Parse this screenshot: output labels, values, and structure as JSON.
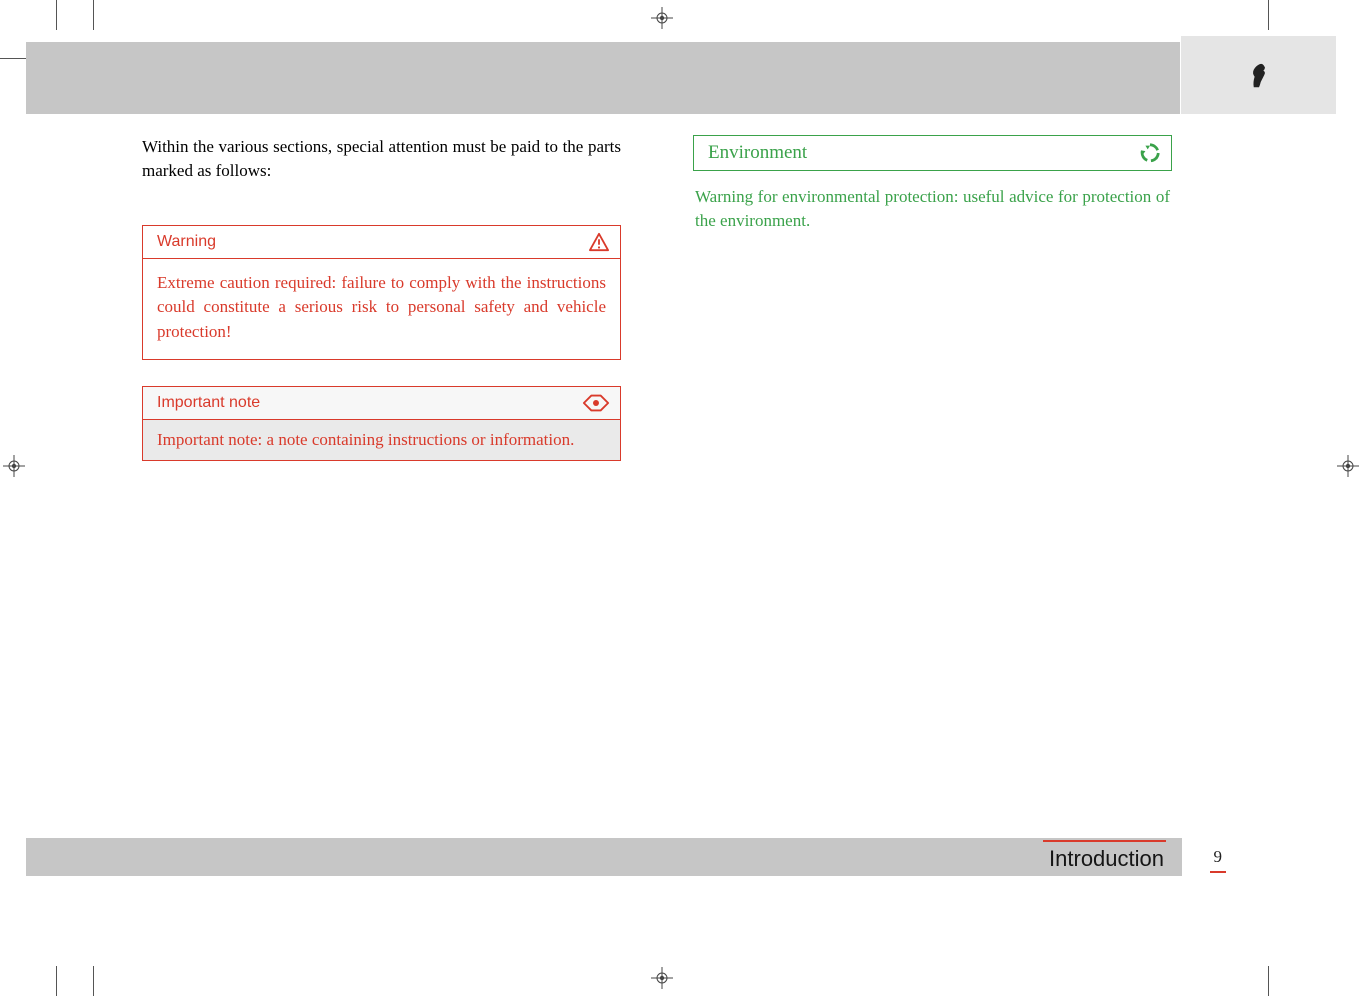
{
  "intro": "Within the various sections, special attention must be paid to the parts marked as follows:",
  "warning": {
    "title": "Warning",
    "body": "Extreme caution required: failure to comply with the instructions could constitute a serious risk to personal safety and vehicle protection!"
  },
  "note": {
    "title": "Important note",
    "body": "Important note: a note containing instructions or information."
  },
  "environment": {
    "title": "Environment",
    "body": "Warning for environmental protection: useful advice for protection of the environment."
  },
  "footer": {
    "section": "Introduction",
    "page": "9"
  }
}
